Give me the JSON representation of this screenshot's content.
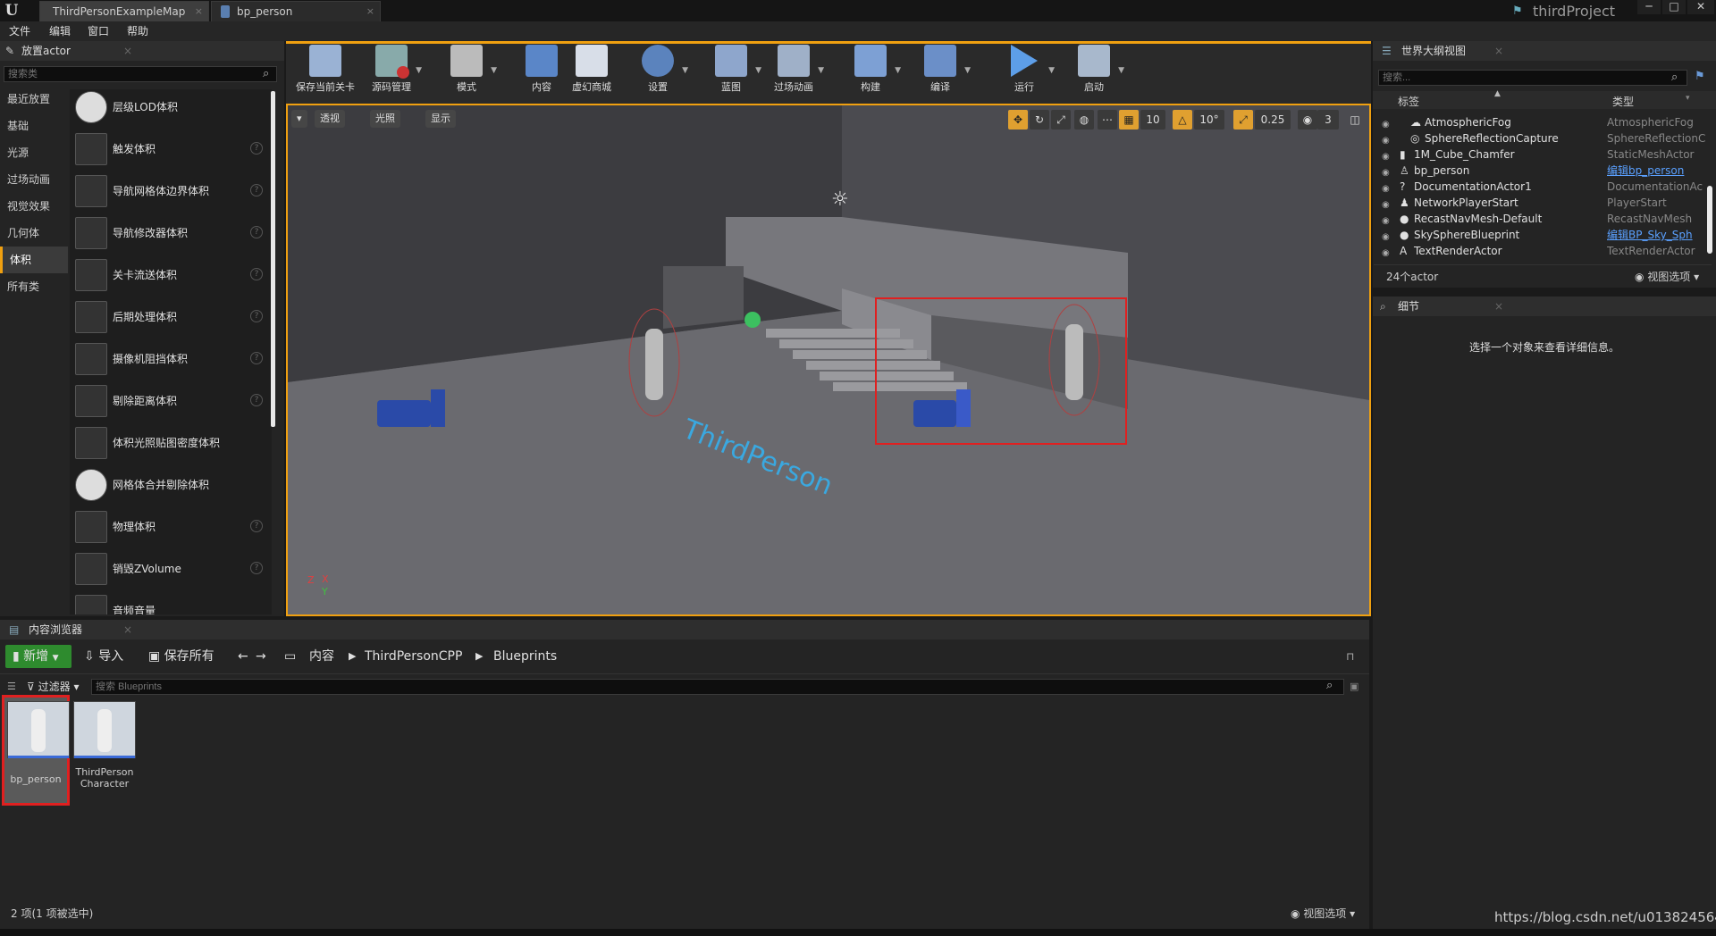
{
  "window": {
    "tabs": [
      "ThirdPersonExampleMap",
      "bp_person"
    ],
    "project": "thirdProject",
    "controls": [
      "─",
      "□",
      "✕"
    ]
  },
  "menu": [
    "文件",
    "编辑",
    "窗口",
    "帮助"
  ],
  "place_panel": {
    "title": "放置actor",
    "search_placeholder": "搜索类",
    "categories": [
      "最近放置",
      "基础",
      "光源",
      "过场动画",
      "视觉效果",
      "几何体",
      "体积",
      "所有类"
    ],
    "selected_category": "体积",
    "items": [
      "层级LOD体积",
      "触发体积",
      "导航网格体边界体积",
      "导航修改器体积",
      "关卡流送体积",
      "后期处理体积",
      "摄像机阻挡体积",
      "剔除距离体积",
      "体积光照贴图密度体积",
      "网格体合并剔除体积",
      "物理体积",
      "销毁ZVolume",
      "音频音量"
    ]
  },
  "toolbar": {
    "buttons": [
      "保存当前关卡",
      "源码管理",
      "模式",
      "内容",
      "虚幻商城",
      "设置",
      "蓝图",
      "过场动画",
      "构建",
      "编译",
      "运行",
      "启动"
    ]
  },
  "viewport": {
    "perspective": "透视",
    "lit": "光照",
    "show": "显示",
    "grid_snap": "10",
    "rot_snap": "10°",
    "scale_snap": "0.25",
    "cam_speed": "3",
    "floor_text": "ThirdPerson"
  },
  "outliner": {
    "title": "世界大纲视图",
    "search_placeholder": "搜索...",
    "col_label": "标签",
    "col_type": "类型",
    "rows": [
      {
        "name": "AtmosphericFog",
        "type": "AtmosphericFog",
        "link": false
      },
      {
        "name": "SphereReflectionCapture",
        "type": "SphereReflectionC",
        "link": false
      },
      {
        "name": "1M_Cube_Chamfer",
        "type": "StaticMeshActor",
        "link": false
      },
      {
        "name": "bp_person",
        "type": "编辑bp_person",
        "link": true
      },
      {
        "name": "DocumentationActor1",
        "type": "DocumentationAc",
        "link": false
      },
      {
        "name": "NetworkPlayerStart",
        "type": "PlayerStart",
        "link": false
      },
      {
        "name": "RecastNavMesh-Default",
        "type": "RecastNavMesh",
        "link": false
      },
      {
        "name": "SkySphereBlueprint",
        "type": "编辑BP_Sky_Sph",
        "link": true
      },
      {
        "name": "TextRenderActor",
        "type": "TextRenderActor",
        "link": false
      }
    ],
    "count": "24个actor",
    "view_options": "视图选项"
  },
  "details": {
    "title": "细节",
    "empty_msg": "选择一个对象来查看详细信息。"
  },
  "content_browser": {
    "title": "内容浏览器",
    "new_btn": "新增",
    "import_btn": "导入",
    "save_all_btn": "保存所有",
    "path": [
      "内容",
      "ThirdPersonCPP",
      "Blueprints"
    ],
    "filter": "过滤器",
    "search_placeholder": "搜索 Blueprints",
    "assets": [
      {
        "name": "bp_person",
        "selected": true
      },
      {
        "name": "ThirdPerson Character",
        "selected": false
      }
    ],
    "status": "2 项(1 项被选中)",
    "view_options": "视图选项"
  },
  "watermark": "https://blog.csdn.net/u013824564",
  "colors": {
    "accent": "#f0a010",
    "highlight_box": "#e02020",
    "link": "#5aa0ff",
    "new_btn": "#2e8b2e"
  }
}
